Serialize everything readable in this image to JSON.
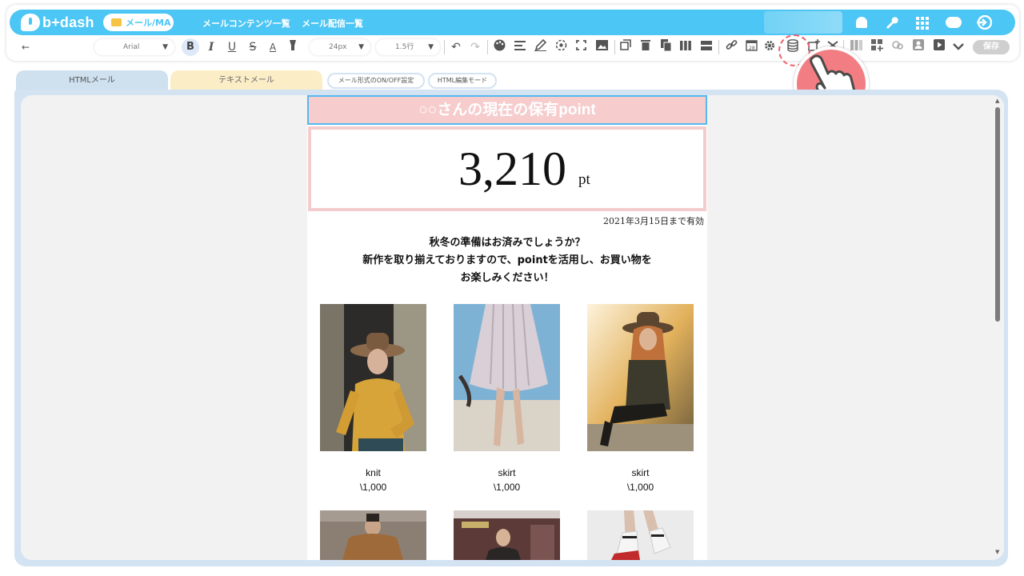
{
  "header": {
    "logo_text": "b+dash",
    "pill_label": "メール/MA",
    "nav_links": [
      "メールコンテンツ一覧",
      "メール配信一覧"
    ],
    "icons": [
      "bell-icon",
      "wrench-icon",
      "apps-grid-icon",
      "user-cloud-icon",
      "logout-icon"
    ]
  },
  "toolbar": {
    "back_icon": "←",
    "font_family": "Arial",
    "font_size": "24px",
    "line_height": "1.5行",
    "bold": "B",
    "italic": "I",
    "underline": "U",
    "strike": "S",
    "font_color": "A",
    "save_label": "保存"
  },
  "tabs": {
    "html": "HTMLメール",
    "text": "テキストメール",
    "onoff": "メール形式のON/OFF設定",
    "html_edit": "HTML編集モード"
  },
  "email": {
    "title": "○○さんの現在の保有point",
    "points": "3,210",
    "unit": "pt",
    "expiry": "2021年3月15日まで有効",
    "message": [
      "秋冬の準備はお済みでしょうか？",
      "新作を取り揃えておりますので、pointを活用し、お買い物を",
      "お楽しみください！"
    ],
    "products": [
      {
        "name": "knit",
        "price": "\\1,000"
      },
      {
        "name": "skirt",
        "price": "\\1,000"
      },
      {
        "name": "skirt",
        "price": "\\1,000"
      }
    ]
  },
  "colors": {
    "brand": "#4cc6f4",
    "accent": "#f27d83",
    "title_bg": "#f6cccd"
  }
}
